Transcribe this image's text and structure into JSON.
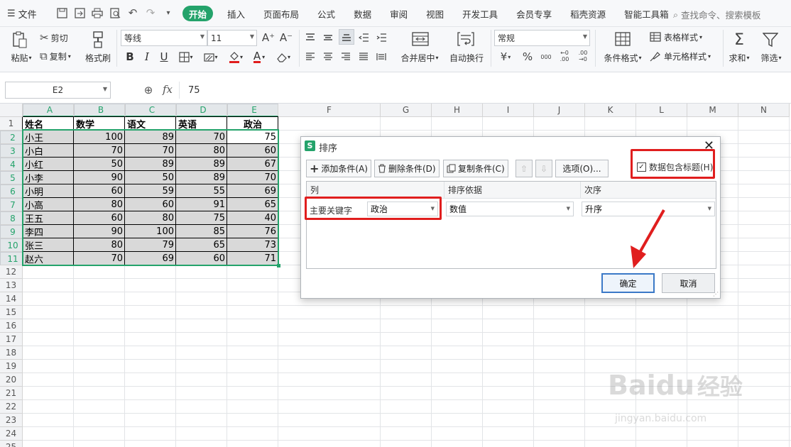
{
  "menubar": {
    "file_label": "文件",
    "tabs": [
      "开始",
      "插入",
      "页面布局",
      "公式",
      "数据",
      "审阅",
      "视图",
      "开发工具",
      "会员专享",
      "稻壳资源",
      "智能工具箱"
    ],
    "search_label": "查找命令、搜索模板"
  },
  "ribbon": {
    "paste": "粘贴",
    "cut": "剪切",
    "copy": "复制",
    "format_painter": "格式刷",
    "font_name": "等线",
    "font_size": "11",
    "merge_center": "合并居中",
    "wrap_text": "自动换行",
    "number_format": "常规",
    "conditional_format": "条件格式",
    "table_style": "表格样式",
    "cell_style": "单元格样式",
    "sum": "求和",
    "filter": "筛选",
    "bold": "B",
    "italic": "I",
    "underline": "U",
    "font_color_glyph": "A",
    "text_color_glyph": "A",
    "increase_font_glyph": "A⁺",
    "decrease_font_glyph": "A⁻",
    "currency_glyph": "¥",
    "percent_glyph": "%",
    "thousands_glyph": "000",
    "dec_inc_glyph": "←0 .00",
    "dec_dec_glyph": ".00 →0"
  },
  "formula_bar": {
    "cell_ref": "E2",
    "fx": "fx",
    "value": "75"
  },
  "grid": {
    "columns": [
      "A",
      "B",
      "C",
      "D",
      "E",
      "F",
      "G",
      "H",
      "I",
      "J",
      "K",
      "L",
      "M",
      "N"
    ],
    "rows": [
      "1",
      "2",
      "3",
      "4",
      "5",
      "6",
      "7",
      "8",
      "9",
      "10",
      "11",
      "12",
      "13",
      "14",
      "15",
      "16",
      "17",
      "18",
      "19",
      "20",
      "21",
      "22",
      "23",
      "24",
      "25"
    ],
    "header": [
      "姓名",
      "数学",
      "语文",
      "英语",
      "政治"
    ],
    "data": [
      [
        "小王",
        "100",
        "89",
        "70",
        "75"
      ],
      [
        "小白",
        "70",
        "70",
        "80",
        "60"
      ],
      [
        "小红",
        "50",
        "89",
        "89",
        "67"
      ],
      [
        "小李",
        "90",
        "50",
        "89",
        "70"
      ],
      [
        "小明",
        "60",
        "59",
        "55",
        "69"
      ],
      [
        "小高",
        "80",
        "60",
        "91",
        "65"
      ],
      [
        "王五",
        "60",
        "80",
        "75",
        "40"
      ],
      [
        "李四",
        "90",
        "100",
        "85",
        "76"
      ],
      [
        "张三",
        "80",
        "79",
        "65",
        "73"
      ],
      [
        "赵六",
        "70",
        "69",
        "60",
        "71"
      ]
    ]
  },
  "dialog": {
    "icon_glyph": "S",
    "title": "排序",
    "add_condition": "添加条件(A)",
    "delete_condition": "删除条件(D)",
    "copy_condition": "复制条件(C)",
    "options": "选项(O)...",
    "include_header": "数据包含标题(H)",
    "header_checked": true,
    "col_header": "列",
    "sort_on_header": "排序依据",
    "order_header": "次序",
    "primary_key_label": "主要关键字",
    "primary_key_value": "政治",
    "sort_on_value": "数值",
    "order_value": "升序",
    "ok": "确定",
    "cancel": "取消"
  },
  "watermark": {
    "brand": "Baidu",
    "brand2": "经验",
    "url": "jingyan.baidu.com"
  },
  "colors": {
    "accent": "#24a36b",
    "highlight": "#e01e1e",
    "selection": "#d9d9d9",
    "ok_border": "#3b79c7"
  }
}
